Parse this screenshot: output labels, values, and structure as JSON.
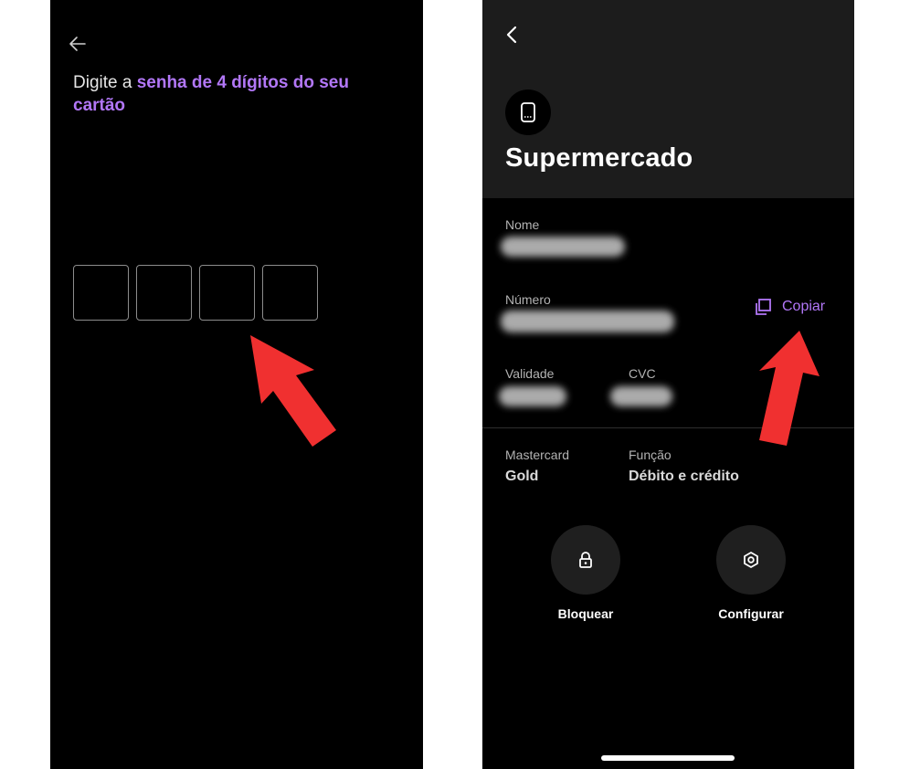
{
  "left_screen": {
    "icons": {
      "back": "arrow-left-icon"
    },
    "heading_prefix": "Digite a ",
    "heading_highlight": "senha de 4 dígitos do seu cartão",
    "pin_boxes": [
      "",
      "",
      "",
      ""
    ],
    "colors": {
      "accent": "#b277f7",
      "background": "#000000"
    }
  },
  "right_screen": {
    "icons": {
      "back": "chevron-left-icon",
      "card": "virtual-card-icon",
      "copy": "copy-icon",
      "lock": "lock-icon",
      "settings": "gear-icon"
    },
    "title": "Supermercado",
    "fields": {
      "name_label": "Nome",
      "number_label": "Número",
      "copy_label": "Copiar",
      "validity_label": "Validade",
      "cvc_label": "CVC",
      "brand_label": "Mastercard",
      "brand_value": "Gold",
      "function_label": "Função",
      "function_value": "Débito e crédito"
    },
    "actions": {
      "block_label": "Bloquear",
      "configure_label": "Configurar"
    },
    "colors": {
      "accent": "#b277f7",
      "header_background": "#1c1c1c"
    }
  },
  "annotations": {
    "arrow_color": "#f03030"
  }
}
